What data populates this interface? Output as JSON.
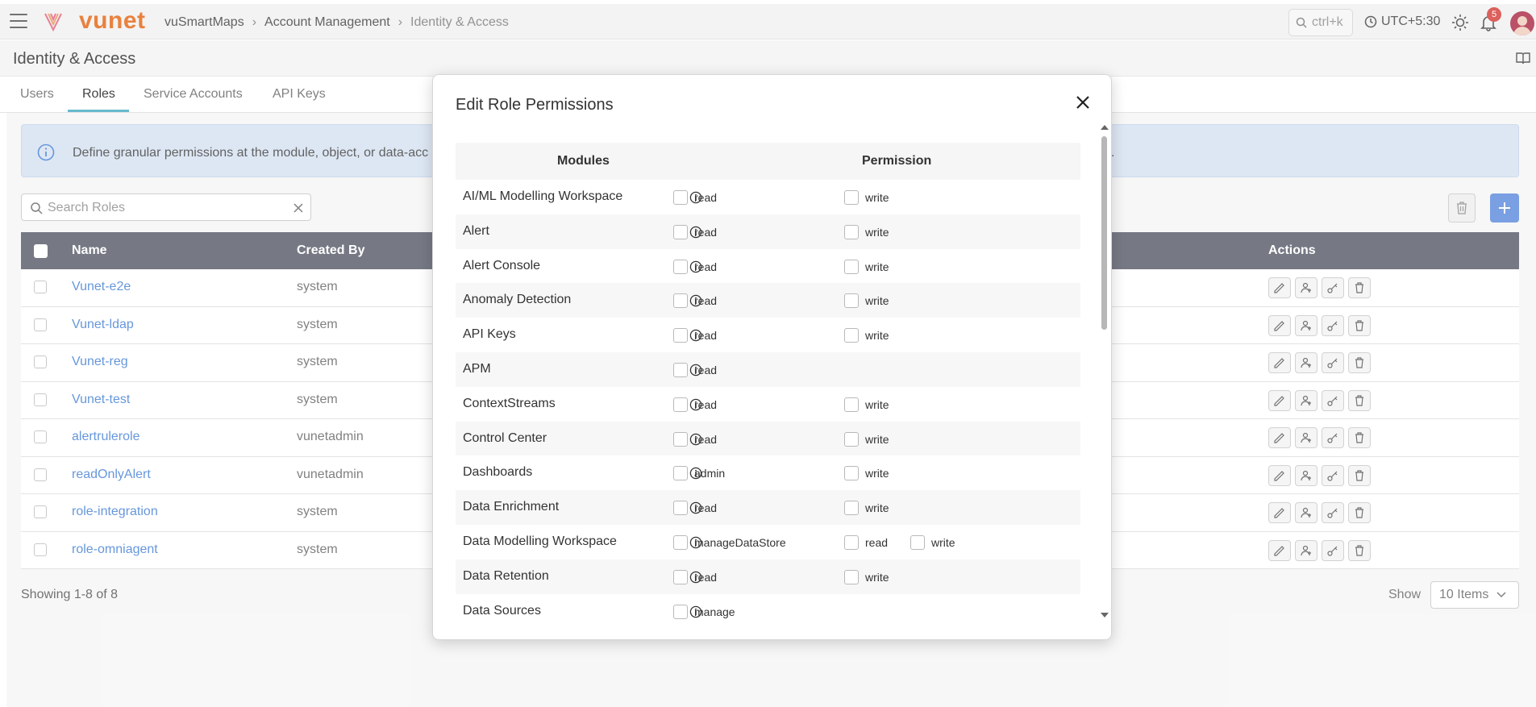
{
  "topbar": {
    "brand": "vunet",
    "breadcrumb": [
      "vuSmartMaps",
      "Account Management",
      "Identity & Access"
    ],
    "search_hint": "ctrl+k",
    "timezone": "UTC+5:30",
    "notification_count": "5"
  },
  "page": {
    "title": "Identity & Access"
  },
  "tabs": [
    {
      "label": "Users",
      "active": false
    },
    {
      "label": "Roles",
      "active": true
    },
    {
      "label": "Service Accounts",
      "active": false
    },
    {
      "label": "API Keys",
      "active": false
    }
  ],
  "banner": {
    "text": "Define granular permissions at the module, object, or data-acc",
    "text_tail": "."
  },
  "search": {
    "placeholder": "Search Roles",
    "value": ""
  },
  "table": {
    "columns": {
      "name": "Name",
      "created_by": "Created By",
      "actions": "Actions"
    },
    "rows": [
      {
        "name": "Vunet-e2e",
        "created_by": "system"
      },
      {
        "name": "Vunet-ldap",
        "created_by": "system"
      },
      {
        "name": "Vunet-reg",
        "created_by": "system"
      },
      {
        "name": "Vunet-test",
        "created_by": "system"
      },
      {
        "name": "alertrulerole",
        "created_by": "vunetadmin"
      },
      {
        "name": "readOnlyAlert",
        "created_by": "vunetadmin"
      },
      {
        "name": "role-integration",
        "created_by": "system"
      },
      {
        "name": "role-omniagent",
        "created_by": "system"
      }
    ]
  },
  "footer": {
    "showing": "Showing 1-8 of 8",
    "show_label": "Show",
    "items_per_page": "10 Items"
  },
  "modal": {
    "title": "Edit Role Permissions",
    "columns": {
      "modules": "Modules",
      "permission": "Permission"
    },
    "rows": [
      {
        "module": "AI/ML Modelling Workspace",
        "perms": [
          "read",
          "write"
        ]
      },
      {
        "module": "Alert",
        "perms": [
          "read",
          "write"
        ]
      },
      {
        "module": "Alert Console",
        "perms": [
          "read",
          "write"
        ]
      },
      {
        "module": "Anomaly Detection",
        "perms": [
          "read",
          "write"
        ]
      },
      {
        "module": "API Keys",
        "perms": [
          "read",
          "write"
        ]
      },
      {
        "module": "APM",
        "perms": [
          "read"
        ]
      },
      {
        "module": "ContextStreams",
        "perms": [
          "read",
          "write"
        ]
      },
      {
        "module": "Control Center",
        "perms": [
          "read",
          "write"
        ]
      },
      {
        "module": "Dashboards",
        "perms": [
          "admin",
          "write"
        ]
      },
      {
        "module": "Data Enrichment",
        "perms": [
          "read",
          "write"
        ]
      },
      {
        "module": "Data Modelling Workspace",
        "perms": [
          "manageDataStore",
          "read",
          "write"
        ]
      },
      {
        "module": "Data Retention",
        "perms": [
          "read",
          "write"
        ]
      },
      {
        "module": "Data Sources",
        "perms": [
          "manage"
        ]
      }
    ]
  },
  "colors": {
    "accent": "#5bb4c8",
    "link": "#5a8fd8",
    "brand": "#e8772e",
    "header_bg": "#6b6e7a",
    "add_button": "#6f97e0"
  }
}
